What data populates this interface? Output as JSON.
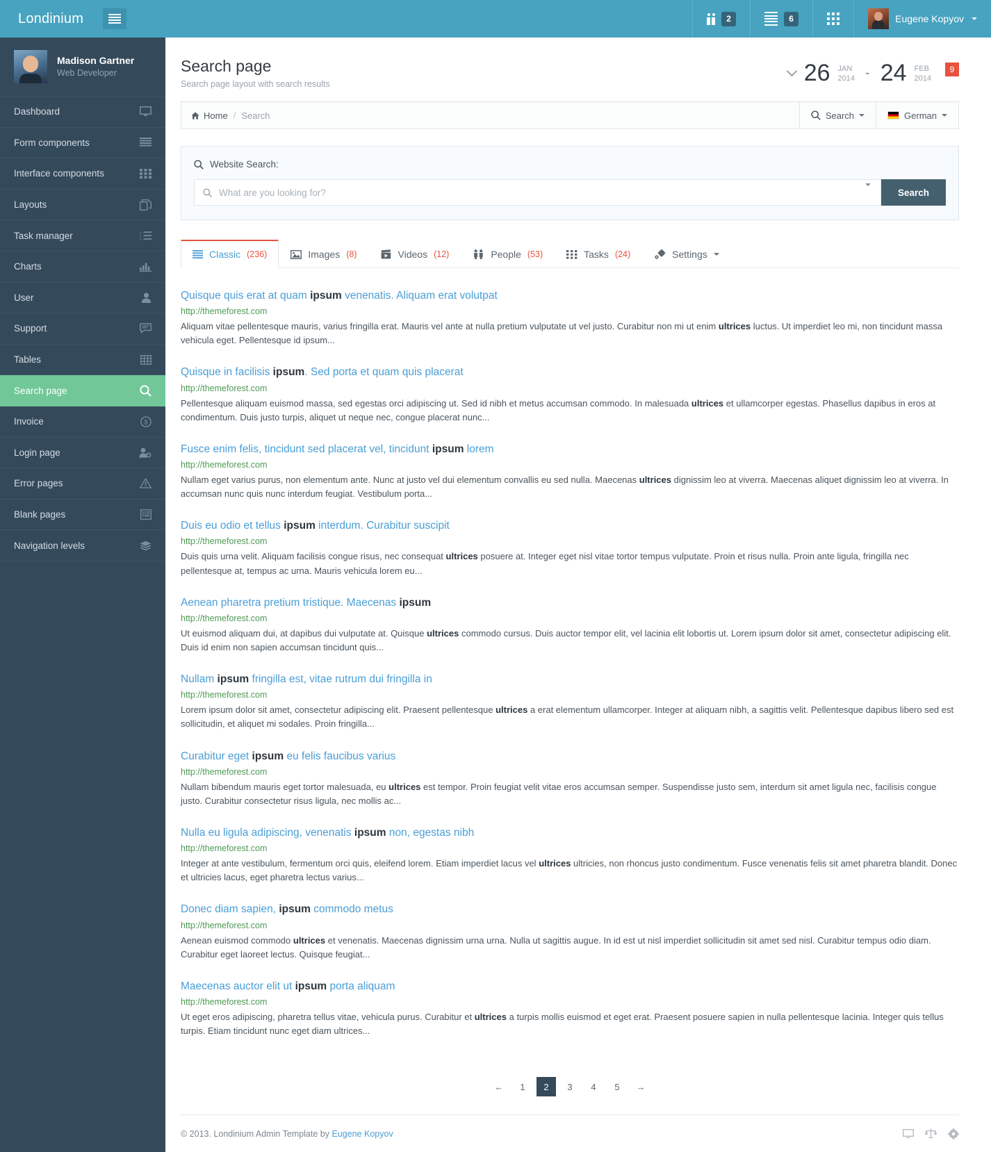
{
  "navbar": {
    "brand": "Londinium",
    "toggle_icon": "hamburger-icon",
    "items": [
      {
        "icon": "people-icon",
        "badge": "2"
      },
      {
        "icon": "lines-icon",
        "badge": "6"
      },
      {
        "icon": "grid-icon",
        "badge": ""
      }
    ],
    "user": {
      "name": "Eugene Kopyov",
      "avatar": "user-avatar"
    }
  },
  "sidebar": {
    "profile": {
      "name": "Madison Gartner",
      "role": "Web Developer"
    },
    "items": [
      {
        "label": "Dashboard",
        "icon": "monitor-icon",
        "active": false
      },
      {
        "label": "Form components",
        "icon": "lines-icon",
        "active": false
      },
      {
        "label": "Interface components",
        "icon": "grid-icon",
        "active": false
      },
      {
        "label": "Layouts",
        "icon": "copy-icon",
        "active": false
      },
      {
        "label": "Task manager",
        "icon": "ordered-list-icon",
        "active": false
      },
      {
        "label": "Charts",
        "icon": "bar-chart-icon",
        "active": false
      },
      {
        "label": "User",
        "icon": "person-icon",
        "active": false
      },
      {
        "label": "Support",
        "icon": "chat-icon",
        "active": false
      },
      {
        "label": "Tables",
        "icon": "table-icon",
        "active": false
      },
      {
        "label": "Search page",
        "icon": "search-icon",
        "active": true
      },
      {
        "label": "Invoice",
        "icon": "dollar-icon",
        "active": false
      },
      {
        "label": "Login page",
        "icon": "user-add-icon",
        "active": false
      },
      {
        "label": "Error pages",
        "icon": "warning-icon",
        "active": false
      },
      {
        "label": "Blank pages",
        "icon": "blank-page-icon",
        "active": false
      },
      {
        "label": "Navigation levels",
        "icon": "layers-icon",
        "active": false
      }
    ]
  },
  "page": {
    "title": "Search page",
    "subtitle": "Search page layout with search results",
    "date_range": {
      "start_day": "26",
      "start_month": "JAN",
      "start_year": "2014",
      "separator": "-",
      "end_day": "24",
      "end_month": "FEB",
      "end_year": "2014",
      "badge": "9"
    }
  },
  "breadcrumb": {
    "home": "Home",
    "separator": "/",
    "current": "Search",
    "actions": [
      {
        "label": "Search",
        "icon": "search-icon"
      },
      {
        "label": "German",
        "icon": "flag-de-icon"
      }
    ]
  },
  "search_panel": {
    "label": "Website Search:",
    "placeholder": "What are you looking for?",
    "value": "",
    "button": "Search"
  },
  "tabs": [
    {
      "label": "Classic",
      "count": "(236)",
      "icon": "lines-icon",
      "active": true
    },
    {
      "label": "Images",
      "count": "(8)",
      "icon": "image-icon",
      "active": false
    },
    {
      "label": "Videos",
      "count": "(12)",
      "icon": "video-icon",
      "active": false
    },
    {
      "label": "People",
      "count": "(53)",
      "icon": "people-icon",
      "active": false
    },
    {
      "label": "Tasks",
      "count": "(24)",
      "icon": "grid-icon",
      "active": false
    },
    {
      "label": "Settings",
      "count": "",
      "icon": "gear-icon",
      "active": false
    }
  ],
  "results": [
    {
      "title_pre": "Quisque quis erat at quam ",
      "title_bold": "ipsum",
      "title_post": " venenatis. Aliquam erat volutpat",
      "url": "http://themeforest.com",
      "desc_pre": "Aliquam vitae pellentesque mauris, varius fringilla erat. Mauris vel ante at nulla pretium vulputate ut vel justo. Curabitur non mi ut enim ",
      "desc_bold": "ultrices",
      "desc_post": " luctus. Ut imperdiet leo mi, non tincidunt massa vehicula eget. Pellentesque id ipsum..."
    },
    {
      "title_pre": "Quisque in facilisis ",
      "title_bold": "ipsum",
      "title_post": ". Sed porta et quam quis placerat",
      "url": "http://themeforest.com",
      "desc_pre": "Pellentesque aliquam euismod massa, sed egestas orci adipiscing ut. Sed id nibh et metus accumsan commodo. In malesuada ",
      "desc_bold": "ultrices",
      "desc_post": " et ullamcorper egestas. Phasellus dapibus in eros at condimentum. Duis justo turpis, aliquet ut neque nec, congue placerat nunc..."
    },
    {
      "title_pre": "Fusce enim felis, tincidunt sed placerat vel, tincidunt ",
      "title_bold": "ipsum",
      "title_post": " lorem",
      "url": "http://themeforest.com",
      "desc_pre": "Nullam eget varius purus, non elementum ante. Nunc at justo vel dui elementum convallis eu sed nulla. Maecenas ",
      "desc_bold": "ultrices",
      "desc_post": " dignissim leo at viverra. Maecenas aliquet dignissim leo at viverra. In accumsan nunc quis nunc interdum feugiat. Vestibulum porta..."
    },
    {
      "title_pre": "Duis eu odio et tellus ",
      "title_bold": "ipsum",
      "title_post": " interdum. Curabitur suscipit",
      "url": "http://themeforest.com",
      "desc_pre": "Duis quis urna velit. Aliquam facilisis congue risus, nec consequat ",
      "desc_bold": "ultrices",
      "desc_post": " posuere at. Integer eget nisl vitae tortor tempus vulputate. Proin et risus nulla. Proin ante ligula, fringilla nec pellentesque at, tempus ac urna. Mauris vehicula lorem eu..."
    },
    {
      "title_pre": "Aenean pharetra pretium tristique. Maecenas ",
      "title_bold": "ipsum",
      "title_post": "",
      "url": "http://themeforest.com",
      "desc_pre": "Ut euismod aliquam dui, at dapibus dui vulputate at. Quisque ",
      "desc_bold": "ultrices",
      "desc_post": " commodo cursus. Duis auctor tempor elit, vel lacinia elit lobortis ut. Lorem ipsum dolor sit amet, consectetur adipiscing elit. Duis id enim non sapien accumsan tincidunt quis..."
    },
    {
      "title_pre": "Nullam ",
      "title_bold": "ipsum",
      "title_post": " fringilla est, vitae rutrum dui fringilla in",
      "url": "http://themeforest.com",
      "desc_pre": "Lorem ipsum dolor sit amet, consectetur adipiscing elit. Praesent pellentesque ",
      "desc_bold": "ultrices",
      "desc_post": " a erat elementum ullamcorper. Integer at aliquam nibh, a sagittis velit. Pellentesque dapibus libero sed est sollicitudin, et aliquet mi sodales. Proin fringilla..."
    },
    {
      "title_pre": "Curabitur eget ",
      "title_bold": "ipsum",
      "title_post": " eu felis faucibus varius",
      "url": "http://themeforest.com",
      "desc_pre": "Nullam bibendum mauris eget tortor malesuada, eu ",
      "desc_bold": "ultrices",
      "desc_post": " est tempor. Proin feugiat velit vitae eros accumsan semper. Suspendisse justo sem, interdum sit amet ligula nec, facilisis congue justo. Curabitur consectetur risus ligula, nec mollis ac..."
    },
    {
      "title_pre": "Nulla eu ligula adipiscing, venenatis ",
      "title_bold": "ipsum",
      "title_post": " non, egestas nibh",
      "url": "http://themeforest.com",
      "desc_pre": "Integer at ante vestibulum, fermentum orci quis, eleifend lorem. Etiam imperdiet lacus vel ",
      "desc_bold": "ultrices",
      "desc_post": " ultricies, non rhoncus justo condimentum. Fusce venenatis felis sit amet pharetra blandit. Donec et ultricies lacus, eget pharetra lectus varius..."
    },
    {
      "title_pre": "Donec diam sapien, ",
      "title_bold": "ipsum",
      "title_post": " commodo metus",
      "url": "http://themeforest.com",
      "desc_pre": "Aenean euismod commodo ",
      "desc_bold": "ultrices",
      "desc_post": " et venenatis. Maecenas dignissim urna urna. Nulla ut sagittis augue. In id est ut nisl imperdiet sollicitudin sit amet sed nisl. Curabitur tempus odio diam. Curabitur eget laoreet lectus. Quisque feugiat..."
    },
    {
      "title_pre": "Maecenas auctor elit ut ",
      "title_bold": "ipsum",
      "title_post": " porta aliquam",
      "url": "http://themeforest.com",
      "desc_pre": "Ut eget eros adipiscing, pharetra tellus vitae, vehicula purus. Curabitur et ",
      "desc_bold": "ultrices",
      "desc_post": " a turpis mollis euismod et eget erat. Praesent posuere sapien in nulla pellentesque lacinia. Integer quis tellus turpis. Etiam tincidunt nunc eget diam ultrices..."
    }
  ],
  "pagination": {
    "prev": "←",
    "pages": [
      "1",
      "2",
      "3",
      "4",
      "5"
    ],
    "active": "2",
    "next": "→"
  },
  "footer": {
    "copyright_pre": "© 2013. Londinium Admin Template by ",
    "author": "Eugene Kopyov",
    "icons": [
      "monitor-icon",
      "scales-icon",
      "gear-icon"
    ]
  }
}
